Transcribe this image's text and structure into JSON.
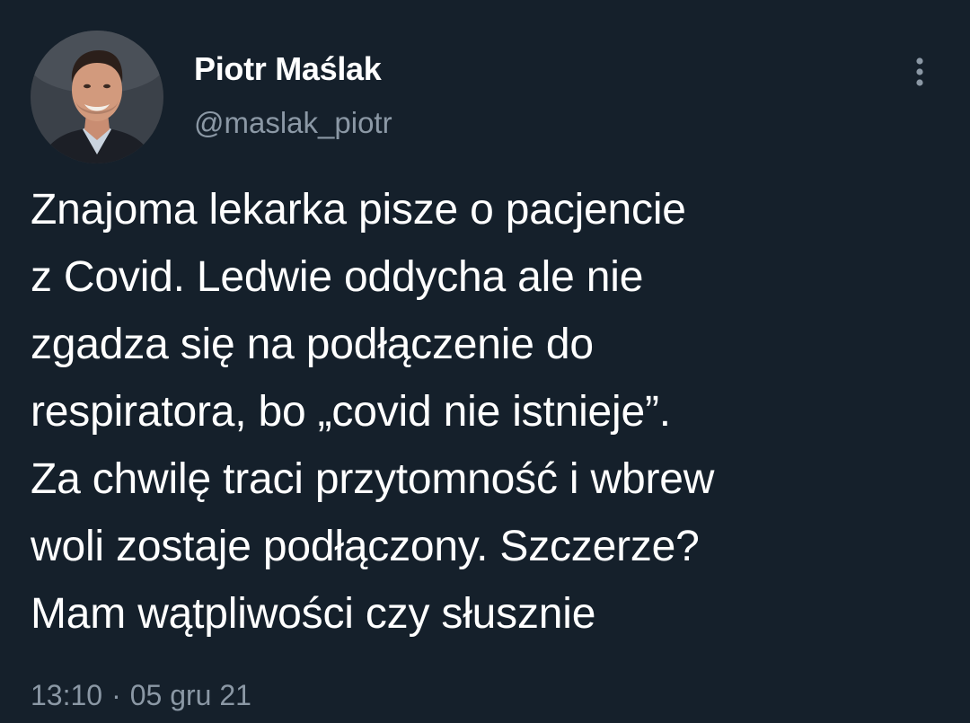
{
  "author": {
    "display_name": "Piotr Maślak",
    "handle": "@maslak_piotr"
  },
  "tweet": {
    "lines": [
      "Znajoma lekarka pisze o pacjencie",
      "z Covid. Ledwie oddycha ale nie",
      "zgadza się na podłączenie do",
      "respiratora, bo „covid nie istnieje”.",
      "Za chwilę traci przytomność i wbrew",
      "woli zostaje podłączony. Szczerze?",
      "Mam wątpliwości czy słusznie"
    ],
    "time": "13:10",
    "separator": "·",
    "date": "05 gru 21"
  },
  "icons": {
    "more": "more-vertical-icon",
    "avatar": "profile-photo"
  },
  "colors": {
    "background": "#15202b",
    "text_primary": "#ffffff",
    "text_secondary": "#8b98a5"
  }
}
